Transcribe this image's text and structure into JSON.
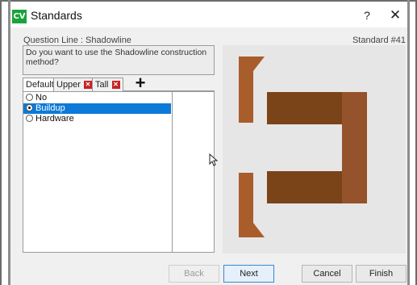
{
  "window": {
    "logo_text": "CV",
    "title": "Standards",
    "help_label": "?",
    "close_label": "✕"
  },
  "question": {
    "line_label": "Question Line : Shadowline",
    "standard_number": "Standard #41",
    "prompt": "Do you want to use the Shadowline construction method?"
  },
  "tabs": [
    {
      "label": "Default",
      "active": true
    },
    {
      "label": "Upper",
      "close": "✕"
    },
    {
      "label": "Tall",
      "close": "✕"
    }
  ],
  "add_tab_label": "+",
  "options": [
    {
      "label": "No",
      "selected": false
    },
    {
      "label": "Buildup",
      "selected": true
    },
    {
      "label": "Hardware",
      "selected": false
    }
  ],
  "footer": {
    "back_label": "Back",
    "next_label": "Next",
    "cancel_label": "Cancel",
    "finish_label": "Finish"
  },
  "colors": {
    "logo_green": "#1aa33a",
    "selection_blue": "#0c7ad8",
    "tab_close_red": "#c82121",
    "wood_light": "#a95d2a",
    "wood_dark": "#7a4318",
    "wood_mid": "#94532a"
  },
  "icons": {
    "logo": "cv-logo-icon",
    "help": "help-icon",
    "close": "close-icon",
    "add_tab": "plus-icon",
    "cursor": "mouse-pointer-icon"
  }
}
